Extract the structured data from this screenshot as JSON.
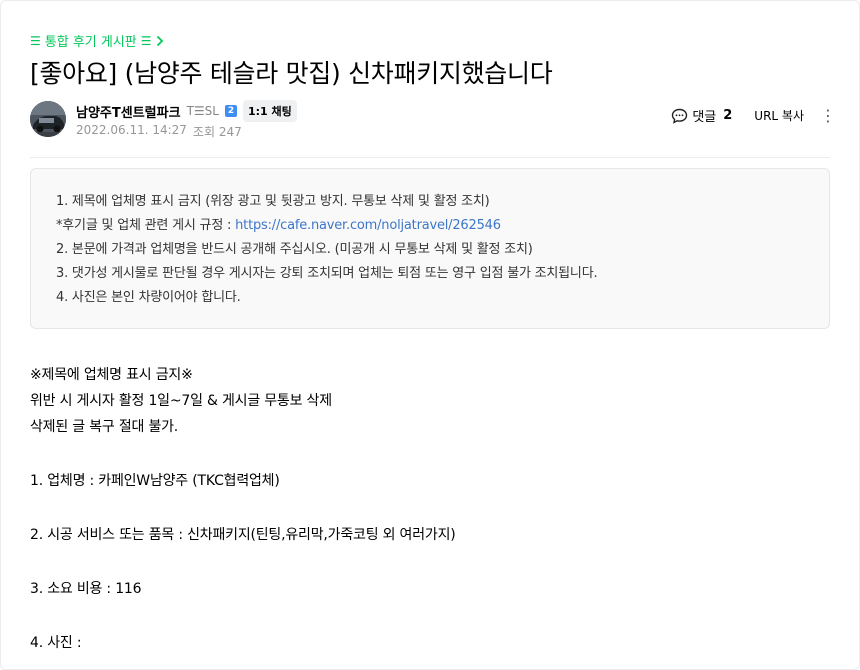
{
  "board_link": {
    "label": "통합 후기 게시판"
  },
  "post": {
    "title": "[좋아요] (남양주 테슬라 맛집) 신차패키지했습니다",
    "author": "남양주T센트럴파크",
    "author_level": "T☰SL",
    "level_badge": "2",
    "chat_label": "1:1 채팅",
    "date": "2022.06.11. 14:27",
    "views_label": "조회 247"
  },
  "tools": {
    "comment_label": "댓글",
    "comment_count": "2",
    "url_copy_label": "URL 복사"
  },
  "notice": {
    "line1": "1. 제목에 업체명 표시 금지 (위장 광고 및 뒷광고 방지. 무통보 삭제 및 활정 조치)",
    "line2_prefix": "*후기글 및 업체 관련 게시 규정 : ",
    "line2_link": "https://cafe.naver.com/noljatravel/262546",
    "line3": "2. 본문에 가격과 업체명을 반드시 공개해 주십시오. (미공개 시 무통보 삭제 및 활정 조치)",
    "line4": "3. 댓가성 게시물로 판단될 경우 게시자는 강퇴 조치되며 업체는 퇴점 또는 영구 입점 불가 조치됩니다.",
    "line5": "4. 사진은 본인 차량이어야 합니다."
  },
  "content": {
    "warn1": "※제목에 업체명 표시 금지※",
    "warn2": "위반 시 게시자 활정 1일~7일 & 게시글 무통보 삭제",
    "warn3": "삭제된 글 복구 절대 불가.",
    "item1": "1. 업체명 :  카페인W남양주 (TKC협력업체)",
    "item2": "2. 시공 서비스 또는 품목 :  신차패키지(틴팅,유리막,가죽코팅 외 여러가지)",
    "item3": "3. 소요 비용 :  116",
    "item4": "4. 사진 :"
  },
  "colors": {
    "accent": "#03c75a",
    "link": "#3d76c9",
    "badge": "#3d8df5"
  }
}
